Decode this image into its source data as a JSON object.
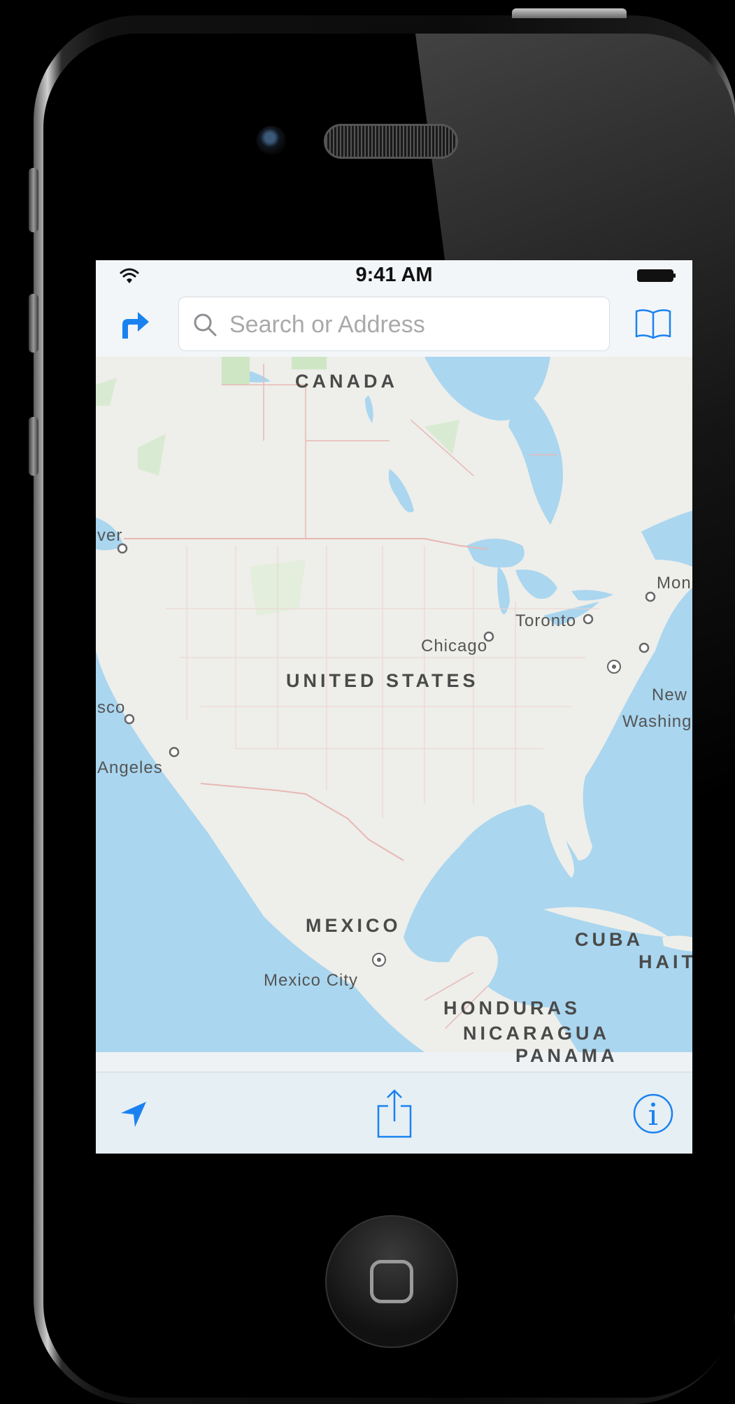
{
  "status_bar": {
    "time": "9:41 AM"
  },
  "search": {
    "placeholder": "Search or Address"
  },
  "map": {
    "countries": {
      "canada": "CANADA",
      "united_states": "UNITED STATES",
      "mexico": "MEXICO",
      "cuba": "CUBA",
      "haiti": "HAIT",
      "honduras": "HONDURAS",
      "nicaragua": "NICARAGUA",
      "panama": "PANAMA"
    },
    "cities": {
      "vancouver": "ver",
      "toronto": "Toronto",
      "chicago": "Chicago",
      "montreal": "Mon",
      "new_york": "New",
      "washington": "Washing",
      "san_francisco": "sco",
      "los_angeles": "Angeles",
      "mexico_city": "Mexico City"
    }
  },
  "icons": {
    "directions": "turn-right-arrow-icon",
    "search": "magnifier-icon",
    "bookmarks": "open-book-icon",
    "location": "location-arrow-icon",
    "share": "share-icon",
    "info": "info-icon"
  },
  "colors": {
    "accent": "#1a82f0",
    "water": "#aad6ef",
    "land": "#eeeeea",
    "park": "#cfe6c5",
    "border": "#e7b8b5"
  }
}
